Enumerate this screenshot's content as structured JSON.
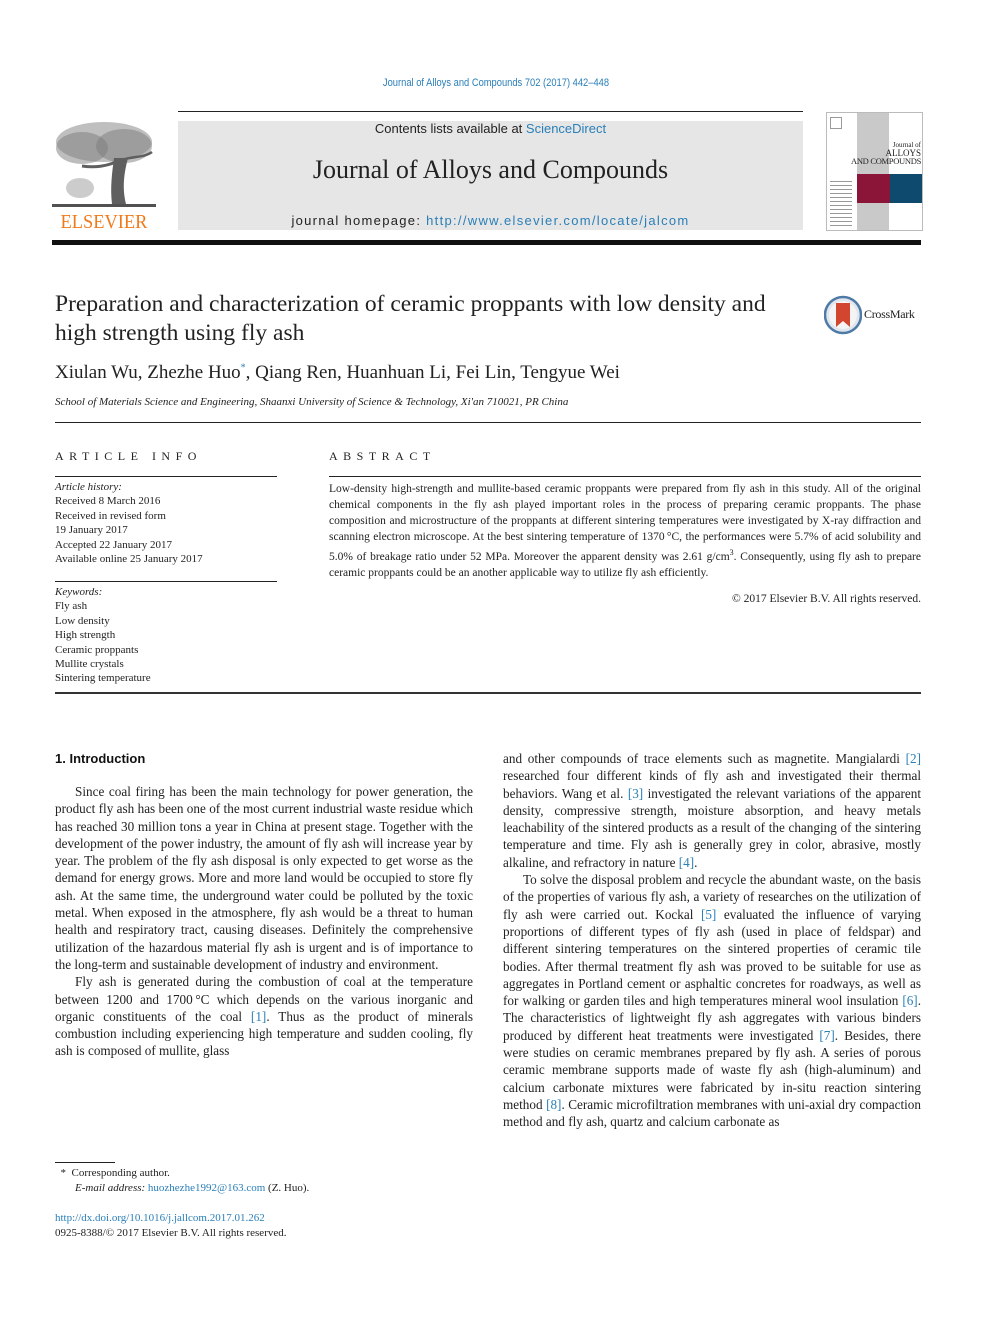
{
  "header": {
    "running_head": "Journal of Alloys and Compounds 702 (2017) 442–448",
    "contents_prefix": "Contents lists available at ",
    "contents_link": "ScienceDirect",
    "journal_title": "Journal of Alloys and Compounds",
    "homepage_prefix": "journal homepage: ",
    "homepage_link": "http://www.elsevier.com/locate/jalcom",
    "publisher_logo_text": "ELSEVIER",
    "cover": {
      "line1": "Journal of",
      "line2": "ALLOYS",
      "line3": "AND COMPOUNDS"
    },
    "colors": {
      "link": "#2a7fb8",
      "elsevier_orange": "#f07a1a",
      "masthead_bg": "#e6e6e6",
      "cover_red": "#8a1538",
      "cover_blue": "#0e4a6e"
    }
  },
  "article": {
    "title": "Preparation and characterization of ceramic proppants with low density and high strength using fly ash",
    "crossmark_label": "CrossMark",
    "authors_before": "Xiulan Wu, Zhezhe Huo",
    "corresponding_mark": "*",
    "authors_after": ", Qiang Ren, Huanhuan Li, Fei Lin, Tengyue Wei",
    "affiliation": "School of Materials Science and Engineering, Shaanxi University of Science & Technology, Xi'an 710021, PR China"
  },
  "article_info": {
    "heading": "ARTICLE INFO",
    "history_label": "Article history:",
    "history": [
      "Received 8 March 2016",
      "Received in revised form",
      "19 January 2017",
      "Accepted 22 January 2017",
      "Available online 25 January 2017"
    ],
    "keywords_label": "Keywords:",
    "keywords": [
      "Fly ash",
      "Low density",
      "High strength",
      "Ceramic proppants",
      "Mullite crystals",
      "Sintering temperature"
    ]
  },
  "abstract": {
    "heading": "ABSTRACT",
    "text_part1": "Low-density high-strength and mullite-based ceramic proppants were prepared from fly ash in this study. All of the original chemical components in the fly ash played important roles in the process of preparing ceramic proppants. The phase composition and microstructure of the proppants at different sintering temperatures were investigated by X-ray diffraction and scanning electron microscope. At the best sintering temperature of 1370 °C, the performances were 5.7% of acid solubility and 5.0% of breakage ratio under 52 MPa. Moreover the apparent density was 2.61 g/cm",
    "superscript": "3",
    "text_part2": ". Consequently, using fly ash to prepare ceramic proppants could be an another applicable way to utilize fly ash efficiently.",
    "copyright": "© 2017 Elsevier B.V. All rights reserved."
  },
  "body": {
    "section_heading": "1.  Introduction",
    "left_p1": "Since coal firing has been the main technology for power generation, the product fly ash has been one of the most current industrial waste residue which has reached 30 million tons a year in China at present stage. Together with the development of the power industry, the amount of fly ash will increase year by year. The problem of the fly ash disposal is only expected to get worse as the demand for energy grows. More and more land would be occupied to store fly ash. At the same time, the underground water could be polluted by the toxic metal. When exposed in the atmosphere, fly ash would be a threat to human health and respiratory tract, causing diseases. Definitely the comprehensive utilization of the hazardous material fly ash is urgent and is of importance to the long-term and sustainable development of industry and environment.",
    "left_p2_a": "Fly ash is generated during the combustion of coal at the temperature between 1200 and 1700 °C which depends on the various inorganic and organic constituents of the coal ",
    "left_p2_ref1": "[1]",
    "left_p2_b": ". Thus as the product of minerals combustion including experiencing high temperature and sudden cooling, fly ash is composed of mullite, glass",
    "right_p1_a": "and other compounds of trace elements such as magnetite. Mangialardi ",
    "right_p1_ref2": "[2]",
    "right_p1_b": " researched four different kinds of fly ash and investigated their thermal behaviors. Wang et al. ",
    "right_p1_ref3": "[3]",
    "right_p1_c": " investigated the relevant variations of the apparent density, compressive strength, moisture absorption, and heavy metals leachability of the sintered products as a result of the changing of the sintering temperature and time. Fly ash is generally grey in color, abrasive, mostly alkaline, and refractory in nature ",
    "right_p1_ref4": "[4]",
    "right_p1_d": ".",
    "right_p2_a": "To solve the disposal problem and recycle the abundant waste, on the basis of the properties of various fly ash, a variety of researches on the utilization of fly ash were carried out. Kockal ",
    "right_p2_ref5": "[5]",
    "right_p2_b": " evaluated the influence of varying proportions of different types of fly ash (used in place of feldspar) and different sintering temperatures on the sintered properties of ceramic tile bodies. After thermal treatment fly ash was proved to be suitable for use as aggregates in Portland cement or asphaltic concretes for roadways, as well as for walking or garden tiles and high temperatures mineral wool insulation ",
    "right_p2_ref6": "[6]",
    "right_p2_c": ". The characteristics of lightweight fly ash aggregates with various binders produced by different heat treatments were investigated ",
    "right_p2_ref7": "[7]",
    "right_p2_d": ". Besides, there were studies on ceramic membranes prepared by fly ash. A series of porous ceramic membrane supports made of waste fly ash (high-aluminum) and calcium carbonate mixtures were fabricated by in-situ reaction sintering method ",
    "right_p2_ref8": "[8]",
    "right_p2_e": ". Ceramic microfiltration membranes with uni-axial dry compaction method and fly ash, quartz and calcium carbonate as"
  },
  "footnotes": {
    "corresponding_mark": "*",
    "corresponding_text": "Corresponding author.",
    "email_label": "E-mail address: ",
    "email": "huozhezhe1992@163.com",
    "email_suffix": " (Z. Huo).",
    "doi": "http://dx.doi.org/10.1016/j.jallcom.2017.01.262",
    "issn_copyright": "0925-8388/© 2017 Elsevier B.V. All rights reserved."
  }
}
